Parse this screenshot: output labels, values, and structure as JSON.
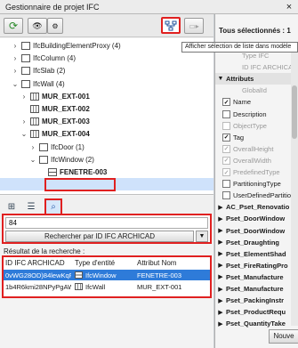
{
  "window": {
    "title": "Gestionnaire de projet IFC",
    "close": "×"
  },
  "toolbar": {
    "eye_label": "👁",
    "eye2_label": "⚙"
  },
  "tooltip": "Afficher sélection de liste dans modèle",
  "tree": [
    {
      "label": "IfcBuildingElementProxy (4)",
      "indent": 2,
      "chevron": "›",
      "bold": false
    },
    {
      "label": "IfcColumn (4)",
      "indent": 2,
      "chevron": "›",
      "bold": false
    },
    {
      "label": "IfcSlab (2)",
      "indent": 2,
      "chevron": "›",
      "bold": false
    },
    {
      "label": "IfcWall (4)",
      "indent": 2,
      "chevron": "⌄",
      "bold": false
    },
    {
      "label": "MUR_EXT-001",
      "indent": 3,
      "chevron": "›",
      "bold": true
    },
    {
      "label": "MUR_EXT-002",
      "indent": 3,
      "chevron": "",
      "bold": true
    },
    {
      "label": "MUR_EXT-003",
      "indent": 3,
      "chevron": "›",
      "bold": true
    },
    {
      "label": "MUR_EXT-004",
      "indent": 3,
      "chevron": "⌄",
      "bold": true
    },
    {
      "label": "IfcDoor (1)",
      "indent": 4,
      "chevron": "›",
      "bold": false
    },
    {
      "label": "IfcWindow (2)",
      "indent": 4,
      "chevron": "⌄",
      "bold": false
    },
    {
      "label": "FENETRE-003",
      "indent": 5,
      "chevron": "",
      "bold": true
    }
  ],
  "search": {
    "value": "84",
    "button_label": "Rechercher par ID IFC ARCHICAD",
    "results_label": "Résultat de la recherche :",
    "columns": [
      "ID IFC ARCHICAD",
      "Type d'entité",
      "Attribut Nom"
    ],
    "rows": [
      {
        "id": "0vWG28OD)84lewKqFZZvXn",
        "type": "IfcWindow",
        "name": "FENETRE-003",
        "selected": true
      },
      {
        "id": "1b4R6kmi28NPyPgAWUu9fY",
        "type": "IfcWall",
        "name": "MUR_EXT-001",
        "selected": false
      }
    ]
  },
  "right_panel": {
    "header": "Tous sélectionnés : 1",
    "rows": [
      {
        "label": "Type IFC",
        "kind": "grey-text"
      },
      {
        "label": "ID IFC ARCHICAD",
        "kind": "grey-text"
      },
      {
        "label": "Attributs",
        "kind": "section"
      },
      {
        "label": "GlobalId",
        "kind": "grey-text"
      },
      {
        "label": "Name",
        "kind": "check",
        "checked": true,
        "disabled": false
      },
      {
        "label": "Description",
        "kind": "check",
        "checked": false,
        "disabled": false
      },
      {
        "label": "ObjectType",
        "kind": "check",
        "checked": false,
        "disabled": true
      },
      {
        "label": "Tag",
        "kind": "check",
        "checked": true,
        "disabled": false
      },
      {
        "label": "OverallHeight",
        "kind": "check",
        "checked": true,
        "disabled": true
      },
      {
        "label": "OverallWidth",
        "kind": "check",
        "checked": true,
        "disabled": true
      },
      {
        "label": "PredefinedType",
        "kind": "check",
        "checked": true,
        "disabled": true
      },
      {
        "label": "PartitioningType",
        "kind": "check",
        "checked": false,
        "disabled": false
      },
      {
        "label": "UserDefinedPartitio",
        "kind": "check",
        "checked": false,
        "disabled": false
      },
      {
        "label": "AC_Pset_Renovatio",
        "kind": "collapsed"
      },
      {
        "label": "Pset_DoorWindow",
        "kind": "collapsed"
      },
      {
        "label": "Pset_DoorWindow",
        "kind": "collapsed"
      },
      {
        "label": "Pset_Draughting",
        "kind": "collapsed"
      },
      {
        "label": "Pset_ElementShad",
        "kind": "collapsed"
      },
      {
        "label": "Pset_FireRatingPro",
        "kind": "collapsed"
      },
      {
        "label": "Pset_Manufacture",
        "kind": "collapsed"
      },
      {
        "label": "Pset_Manufacture",
        "kind": "collapsed"
      },
      {
        "label": "Pset_PackingInstr",
        "kind": "collapsed"
      },
      {
        "label": "Pset_ProductRequ",
        "kind": "collapsed"
      },
      {
        "label": "Pset_QuantityTake",
        "kind": "collapsed"
      }
    ],
    "new_button": "Nouve"
  }
}
